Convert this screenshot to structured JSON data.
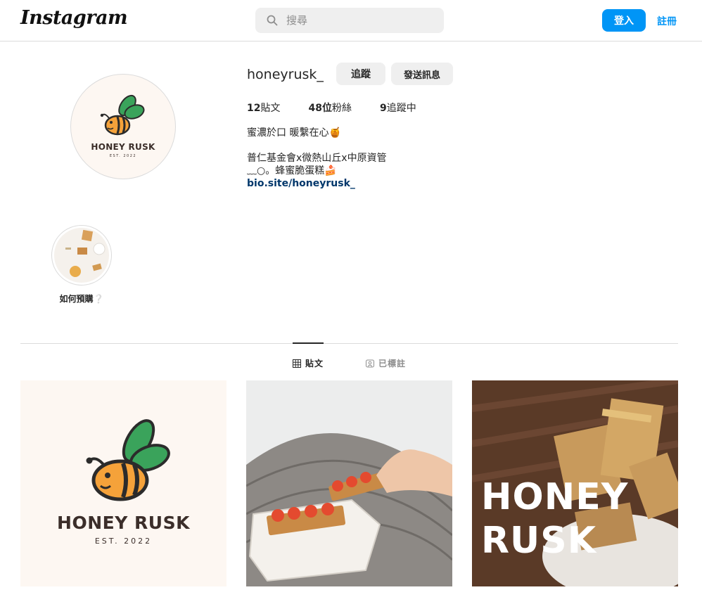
{
  "header": {
    "logo": "Instagram",
    "search_placeholder": "搜尋",
    "login_label": "登入",
    "signup_label": "註冊"
  },
  "profile": {
    "username": "honeyrusk_",
    "follow_label": "追蹤",
    "message_label": "發送訊息",
    "stats": {
      "posts_count": "12",
      "posts_label": "貼文",
      "followers_count": "48位",
      "followers_label": "粉絲",
      "following_count": "9",
      "following_label": "追蹤中"
    },
    "bio": {
      "line1": "蜜濃於口 暖繫在心🍯",
      "line2": "普仁基金會x微熱山丘x中原資管",
      "line3": "﹏○。蜂蜜脆蛋糕🍰",
      "link": "bio.site/honeyrusk_"
    },
    "avatar_brand": "HONEY RUSK",
    "avatar_est": "EST. 2022"
  },
  "highlights": [
    {
      "label": "如何預購❔"
    }
  ],
  "tabs": [
    {
      "label": "貼文",
      "icon": "grid-icon",
      "active": true
    },
    {
      "label": "已標註",
      "icon": "tagged-icon",
      "active": false
    }
  ],
  "posts": [
    {
      "brand": "HONEY RUSK",
      "est": "EST. 2022"
    },
    {
      "subject": "rusk-with-tomato-photo"
    },
    {
      "line1": "HONEY",
      "line2": "RUSK"
    }
  ],
  "colors": {
    "accent": "#0095f6",
    "link": "#00376b",
    "honey": "#f5a23a",
    "leaf": "#3aa35b"
  }
}
